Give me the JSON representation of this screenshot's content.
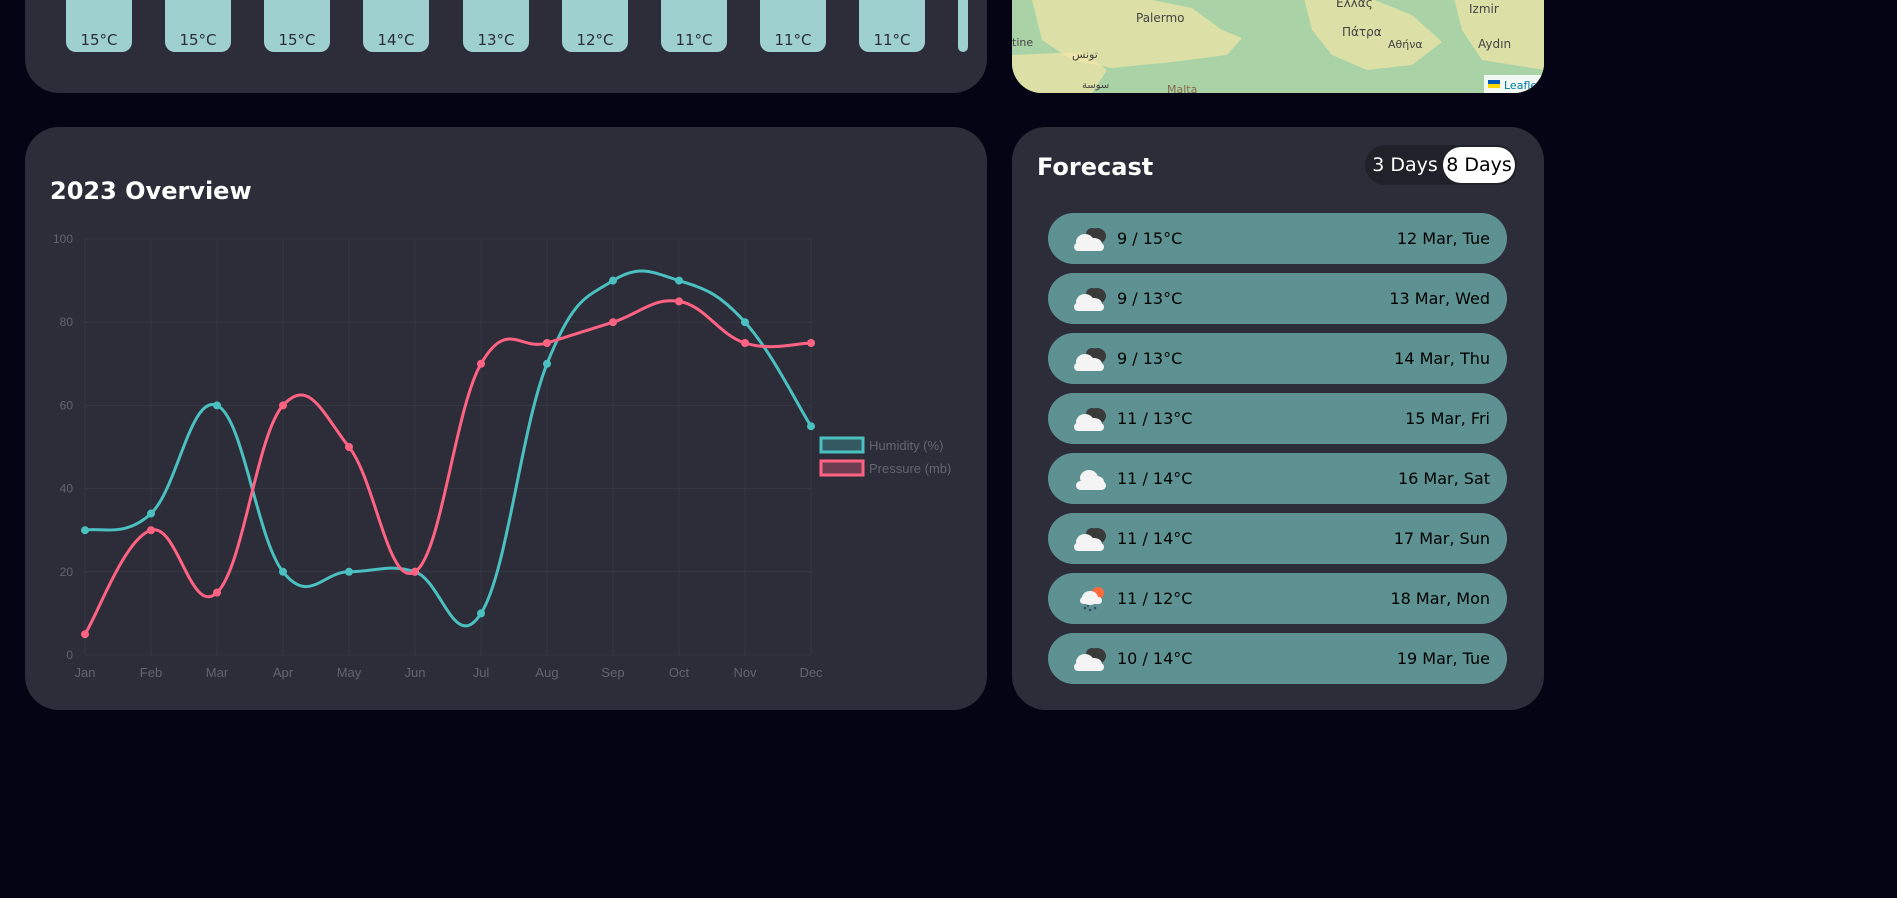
{
  "hourly": {
    "temps": [
      "15°C",
      "15°C",
      "15°C",
      "14°C",
      "13°C",
      "12°C",
      "11°C",
      "11°C",
      "11°C"
    ]
  },
  "map": {
    "labels": [
      "Palermo",
      "Ελλάς",
      "Izmir",
      "Πάτρα",
      "Αθήνα",
      "Aydın",
      "tine",
      "تونس",
      "سوسة",
      "Malta",
      "Leaflet"
    ],
    "land_color": "#f2e6a8",
    "sea_color": "#a9d3a6"
  },
  "overview": {
    "title": "2023 Overview"
  },
  "chart_data": {
    "type": "line",
    "categories": [
      "Jan",
      "Feb",
      "Mar",
      "Apr",
      "May",
      "Jun",
      "Jul",
      "Aug",
      "Sep",
      "Oct",
      "Nov",
      "Dec"
    ],
    "series": [
      {
        "name": "Humidity (%)",
        "color": "#4bc0c0",
        "values": [
          30,
          34,
          60,
          20,
          20,
          20,
          10,
          70,
          90,
          90,
          80,
          55
        ]
      },
      {
        "name": "Pressure (mb)",
        "color": "#ff6384",
        "values": [
          5,
          30,
          15,
          60,
          50,
          20,
          70,
          75,
          80,
          85,
          75,
          75
        ]
      }
    ],
    "ylim": [
      0,
      100
    ],
    "yticks": [
      0,
      20,
      40,
      60,
      80,
      100
    ],
    "grid": true,
    "legend": "right"
  },
  "forecast": {
    "title": "Forecast",
    "toggle": {
      "three_days": "3 Days",
      "eight_days": "8 Days"
    },
    "days": [
      {
        "temp": "9 / 15°C",
        "date": "12 Mar, Tue",
        "icon": "cloudy-icon"
      },
      {
        "temp": "9 / 13°C",
        "date": "13 Mar, Wed",
        "icon": "cloudy-icon"
      },
      {
        "temp": "9 / 13°C",
        "date": "14 Mar, Thu",
        "icon": "cloudy-icon"
      },
      {
        "temp": "11 / 13°C",
        "date": "15 Mar, Fri",
        "icon": "cloudy-icon"
      },
      {
        "temp": "11 / 14°C",
        "date": "16 Mar, Sat",
        "icon": "cloud-icon"
      },
      {
        "temp": "11 / 14°C",
        "date": "17 Mar, Sun",
        "icon": "cloudy-icon"
      },
      {
        "temp": "11 / 12°C",
        "date": "18 Mar, Mon",
        "icon": "rain-sun-icon"
      },
      {
        "temp": "10 / 14°C",
        "date": "19 Mar, Tue",
        "icon": "cloudy-icon"
      }
    ]
  }
}
